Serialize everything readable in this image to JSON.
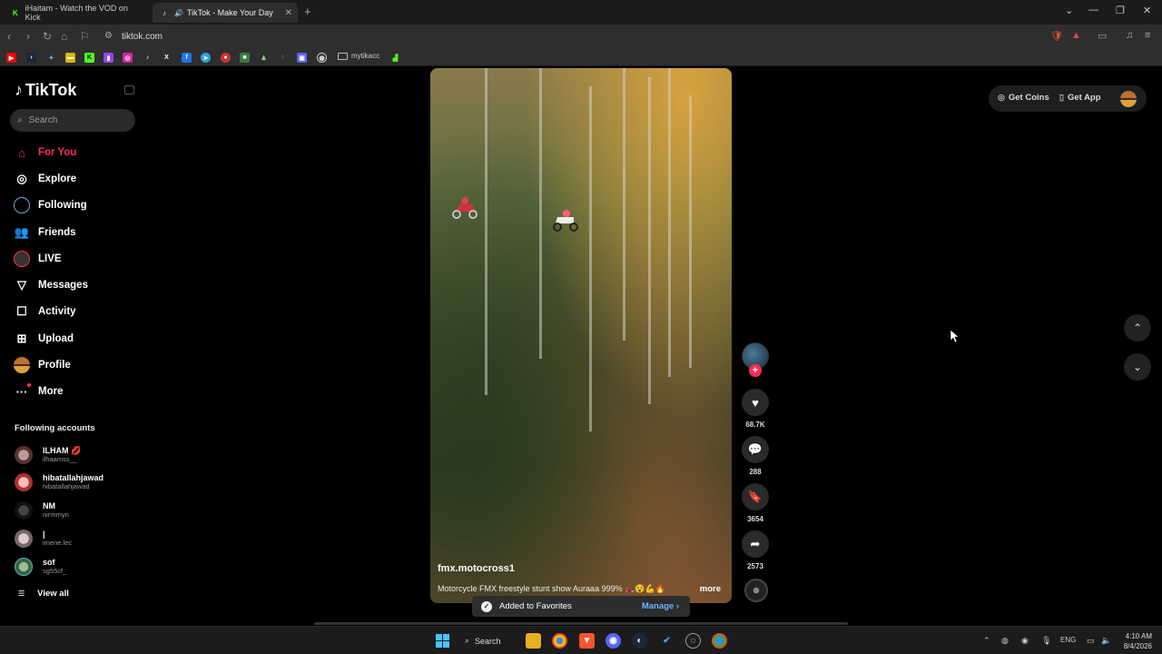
{
  "browser": {
    "tabs": [
      {
        "title": "iHaitam - Watch the VOD on Kick",
        "icon": "kick-icon",
        "active": false
      },
      {
        "title": "TikTok - Make Your Day",
        "icon": "tiktok-icon",
        "active": true
      }
    ],
    "url": "tiktok.com",
    "bookmark_folder": "mytikacc"
  },
  "tiktok": {
    "logo_text": "TikTok",
    "search_placeholder": "Search",
    "menu": [
      {
        "label": "For You",
        "icon": "home-icon",
        "active": true
      },
      {
        "label": "Explore",
        "icon": "compass-icon"
      },
      {
        "label": "Following",
        "icon": "following-icon"
      },
      {
        "label": "Friends",
        "icon": "friends-icon"
      },
      {
        "label": "LIVE",
        "icon": "live-icon"
      },
      {
        "label": "Messages",
        "icon": "messages-icon"
      },
      {
        "label": "Activity",
        "icon": "activity-icon"
      },
      {
        "label": "Upload",
        "icon": "upload-icon"
      },
      {
        "label": "Profile",
        "icon": "profile-icon"
      },
      {
        "label": "More",
        "icon": "more-icon"
      }
    ],
    "following_title": "Following accounts",
    "following": [
      {
        "name": "ILHAM 💋",
        "username": "ilhaamss__"
      },
      {
        "name": "hibatallahjawad",
        "username": "hibatallahjawad"
      },
      {
        "name": "NM",
        "username": "nirmmyn"
      },
      {
        "name": "|",
        "username": "imene.lec"
      },
      {
        "name": "sof",
        "username": "sg55cf_"
      }
    ],
    "view_all": "View all",
    "top_actions": {
      "coins": "Get Coins",
      "app": "Get App"
    },
    "video": {
      "author": "fmx.motocross1",
      "description": "Motorcycle FMX freestyle stunt show Auraaa 999% 🏍️😵💪🔥",
      "more": "more"
    },
    "actions": {
      "likes": "68.7K",
      "comments": "288",
      "saves": "3654",
      "shares": "2573"
    },
    "toast": {
      "message": "Added to Favorites",
      "manage": "Manage"
    },
    "accent_color": "#fe2c55"
  },
  "taskbar": {
    "search_label": "Search",
    "language": "ENG",
    "time": "4:10 AM",
    "date": "8/4/2026"
  }
}
